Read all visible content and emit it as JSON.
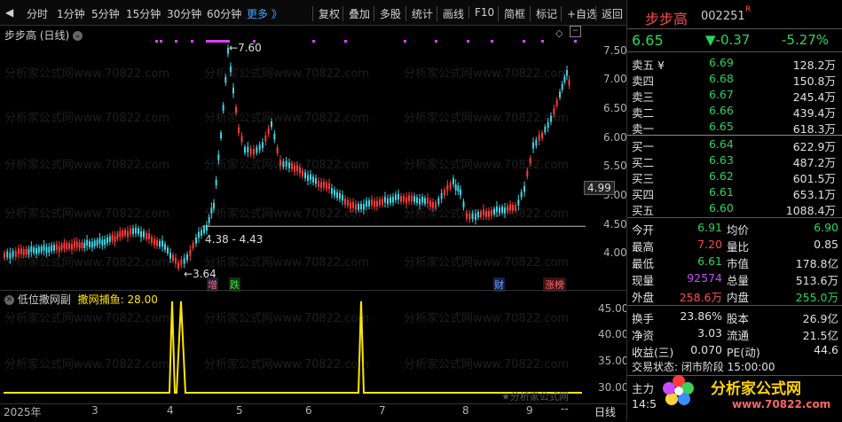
{
  "toolbar": {
    "periods": [
      "分时",
      "1分钟",
      "5分钟",
      "15分钟",
      "30分钟",
      "60分钟"
    ],
    "more": "更多 》",
    "actions": [
      "复权",
      "叠加",
      "多股",
      "统计",
      "画线",
      "F10",
      "简框",
      "标记",
      "+自选",
      "返回"
    ]
  },
  "main_chart": {
    "title": "步步高 (日线)",
    "price_axis": [
      "7.50",
      "7.00",
      "6.50",
      "6.00",
      "5.50",
      "5.00",
      "4.50",
      "4.00"
    ],
    "current_price_tag": "4.99",
    "annotations": {
      "high": "7.60",
      "low": "3.64",
      "range": "4.38 - 4.43"
    },
    "event_tags": {
      "zeng": "增",
      "die": "跌",
      "cai": "财",
      "zhangbang": "涨榜"
    }
  },
  "sub_chart": {
    "title": "低位撒网副",
    "indicator_label": "撒网捕鱼: 28.00",
    "axis": [
      "45.00",
      "40.00",
      "35.00",
      "30.00"
    ],
    "watermark": "★分析家公式网"
  },
  "time_axis": [
    "2025年",
    "3",
    "4",
    "5",
    "6",
    "7",
    "8",
    "9"
  ],
  "period_label": "日线",
  "watermark_text": "分析家公式网www.70822.com",
  "quote": {
    "name": "步步高",
    "code": "002251",
    "flag": "R",
    "price": "6.65",
    "change": "▼-0.37",
    "change_pct": "-5.27%",
    "asks": [
      {
        "label": "卖五 ¥",
        "price": "6.69",
        "vol": "128.2万"
      },
      {
        "label": "卖四",
        "price": "6.68",
        "vol": "150.8万"
      },
      {
        "label": "卖三",
        "price": "6.67",
        "vol": "245.4万"
      },
      {
        "label": "卖二",
        "price": "6.66",
        "vol": "439.4万"
      },
      {
        "label": "卖一",
        "price": "6.65",
        "vol": "618.3万"
      }
    ],
    "bids": [
      {
        "label": "买一",
        "price": "6.64",
        "vol": "622.9万"
      },
      {
        "label": "买二",
        "price": "6.63",
        "vol": "487.2万"
      },
      {
        "label": "买三",
        "price": "6.62",
        "vol": "601.5万"
      },
      {
        "label": "买四",
        "price": "6.61",
        "vol": "653.1万"
      },
      {
        "label": "买五",
        "price": "6.60",
        "vol": "1088.4万"
      }
    ],
    "stats": {
      "open_l": "今开",
      "open": "6.91",
      "avg_l": "均价",
      "avg": "6.90",
      "high_l": "最高",
      "high": "7.20",
      "vr_l": "量比",
      "vr": "0.85",
      "low_l": "最低",
      "low": "6.61",
      "mv_l": "市值",
      "mv": "178.8亿",
      "now_l": "现量",
      "now": "92574",
      "tv_l": "总量",
      "tv": "513.6万",
      "out_l": "外盘",
      "out": "258.6万",
      "in_l": "内盘",
      "in": "255.0万",
      "tr_l": "换手",
      "tr": "23.86%",
      "cap_l": "股本",
      "cap": "26.9亿",
      "na_l": "净资",
      "na": "3.03",
      "fl_l": "流通",
      "fl": "21.5亿",
      "eps_l": "收益(三)",
      "eps": "0.070",
      "pe_l": "PE(动)",
      "pe": "44.6"
    },
    "status": "交易状态: 闭市阶段 15:00:00",
    "bottom_left": "主力",
    "bottom_time": "14:5",
    "logo_text": "分析家公式网",
    "logo_url": "www.70822.com"
  }
}
